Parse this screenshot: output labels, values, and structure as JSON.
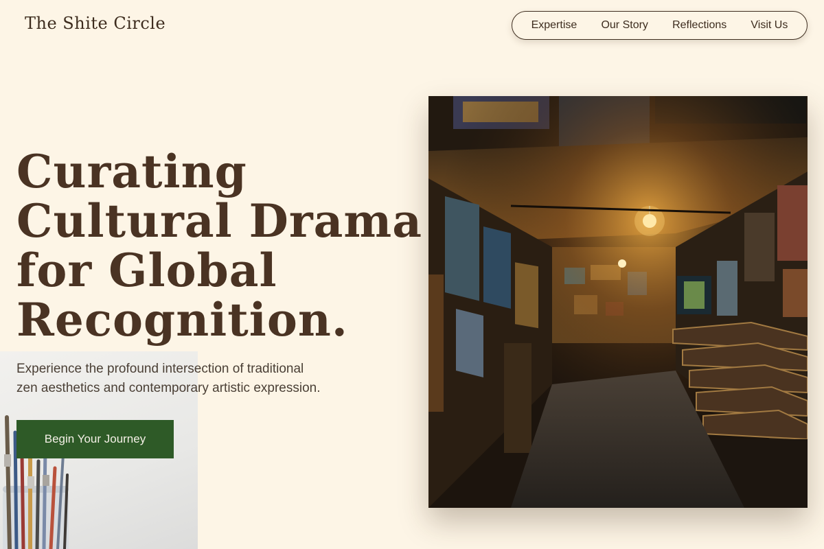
{
  "brand": {
    "name": "The Shite Circle"
  },
  "nav": {
    "items": [
      {
        "label": "Expertise"
      },
      {
        "label": "Our Story"
      },
      {
        "label": "Reflections"
      },
      {
        "label": "Visit Us"
      }
    ]
  },
  "hero": {
    "headline_lines": [
      "Curating",
      "Cultural Drama",
      "for Global",
      "Recognition."
    ],
    "subtitle_lines": [
      "Experience the profound intersection of traditional",
      "zen aesthetics and contemporary artistic expression."
    ],
    "cta_label": "Begin Your Journey"
  },
  "colors": {
    "background": "#fdf5e6",
    "text": "#4a3323",
    "cta": "#2e5a27"
  }
}
